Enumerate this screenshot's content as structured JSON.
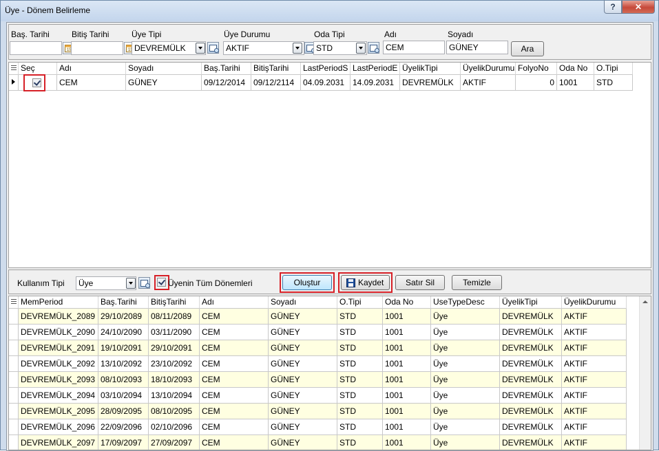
{
  "window": {
    "title": "Üye - Dönem Belirleme",
    "help_label": "?",
    "close_label": "✕"
  },
  "filter": {
    "start_label": "Baş. Tarihi",
    "end_label": "Bitiş Tarihi",
    "member_type_label": "Üye Tipi",
    "member_type_value": "DEVREMÜLK",
    "member_status_label": "Üye Durumu",
    "member_status_value": "AKTIF",
    "room_type_label": "Oda Tipi",
    "room_type_value": "STD",
    "name_label": "Adı",
    "name_value": "CEM",
    "surname_label": "Soyadı",
    "surname_value": "GÜNEY",
    "search_button": "Ara"
  },
  "top_grid": {
    "columns": [
      "Seç",
      "Adı",
      "Soyadı",
      "Baş.Tarihi",
      "BitişTarihi",
      "LastPeriodS",
      "LastPeriodE",
      "ÜyelikTipi",
      "ÜyelikDurumu",
      "FolyoNo",
      "Oda No",
      "O.Tipi"
    ],
    "row": {
      "selected": true,
      "name": "CEM",
      "surname": "GÜNEY",
      "start": "09/12/2014",
      "end": "09/12/2114",
      "last_start": "04.09.2031",
      "last_end": "14.09.2031",
      "membership_type": "DEVREMÜLK",
      "membership_status": "AKTIF",
      "folio_no": "0",
      "room_no": "1001",
      "room_type": "STD"
    }
  },
  "actions": {
    "usage_type_label": "Kullanım Tipi",
    "usage_type_value": "Üye",
    "all_periods_label": "Üyenin Tüm Dönemleri",
    "all_periods_checked": true,
    "create_button": "Oluştur",
    "save_button": "Kaydet",
    "delete_row_button": "Satır Sil",
    "clear_button": "Temizle"
  },
  "bottom_grid": {
    "columns": [
      "MemPeriod",
      "Baş.Tarihi",
      "BitişTarihi",
      "Adı",
      "Soyadı",
      "O.Tipi",
      "Oda No",
      "UseTypeDesc",
      "ÜyelikTipi",
      "ÜyelikDurumu"
    ],
    "rows": [
      {
        "period": "DEVREMÜLK_2089",
        "start": "29/10/2089",
        "end": "08/11/2089",
        "name": "CEM",
        "surname": "GÜNEY",
        "room_type": "STD",
        "room_no": "1001",
        "use_type": "Üye",
        "membership_type": "DEVREMÜLK",
        "membership_status": "AKTIF"
      },
      {
        "period": "DEVREMÜLK_2090",
        "start": "24/10/2090",
        "end": "03/11/2090",
        "name": "CEM",
        "surname": "GÜNEY",
        "room_type": "STD",
        "room_no": "1001",
        "use_type": "Üye",
        "membership_type": "DEVREMÜLK",
        "membership_status": "AKTIF"
      },
      {
        "period": "DEVREMÜLK_2091",
        "start": "19/10/2091",
        "end": "29/10/2091",
        "name": "CEM",
        "surname": "GÜNEY",
        "room_type": "STD",
        "room_no": "1001",
        "use_type": "Üye",
        "membership_type": "DEVREMÜLK",
        "membership_status": "AKTIF"
      },
      {
        "period": "DEVREMÜLK_2092",
        "start": "13/10/2092",
        "end": "23/10/2092",
        "name": "CEM",
        "surname": "GÜNEY",
        "room_type": "STD",
        "room_no": "1001",
        "use_type": "Üye",
        "membership_type": "DEVREMÜLK",
        "membership_status": "AKTIF"
      },
      {
        "period": "DEVREMÜLK_2093",
        "start": "08/10/2093",
        "end": "18/10/2093",
        "name": "CEM",
        "surname": "GÜNEY",
        "room_type": "STD",
        "room_no": "1001",
        "use_type": "Üye",
        "membership_type": "DEVREMÜLK",
        "membership_status": "AKTIF"
      },
      {
        "period": "DEVREMÜLK_2094",
        "start": "03/10/2094",
        "end": "13/10/2094",
        "name": "CEM",
        "surname": "GÜNEY",
        "room_type": "STD",
        "room_no": "1001",
        "use_type": "Üye",
        "membership_type": "DEVREMÜLK",
        "membership_status": "AKTIF"
      },
      {
        "period": "DEVREMÜLK_2095",
        "start": "28/09/2095",
        "end": "08/10/2095",
        "name": "CEM",
        "surname": "GÜNEY",
        "room_type": "STD",
        "room_no": "1001",
        "use_type": "Üye",
        "membership_type": "DEVREMÜLK",
        "membership_status": "AKTIF"
      },
      {
        "period": "DEVREMÜLK_2096",
        "start": "22/09/2096",
        "end": "02/10/2096",
        "name": "CEM",
        "surname": "GÜNEY",
        "room_type": "STD",
        "room_no": "1001",
        "use_type": "Üye",
        "membership_type": "DEVREMÜLK",
        "membership_status": "AKTIF"
      },
      {
        "period": "DEVREMÜLK_2097",
        "start": "17/09/2097",
        "end": "27/09/2097",
        "name": "CEM",
        "surname": "GÜNEY",
        "room_type": "STD",
        "room_no": "1001",
        "use_type": "Üye",
        "membership_type": "DEVREMÜLK",
        "membership_status": "AKTIF"
      }
    ]
  },
  "colors": {
    "row_alt": "#ffffe1",
    "row": "#ffffff",
    "highlight_box": "#d61f26"
  }
}
